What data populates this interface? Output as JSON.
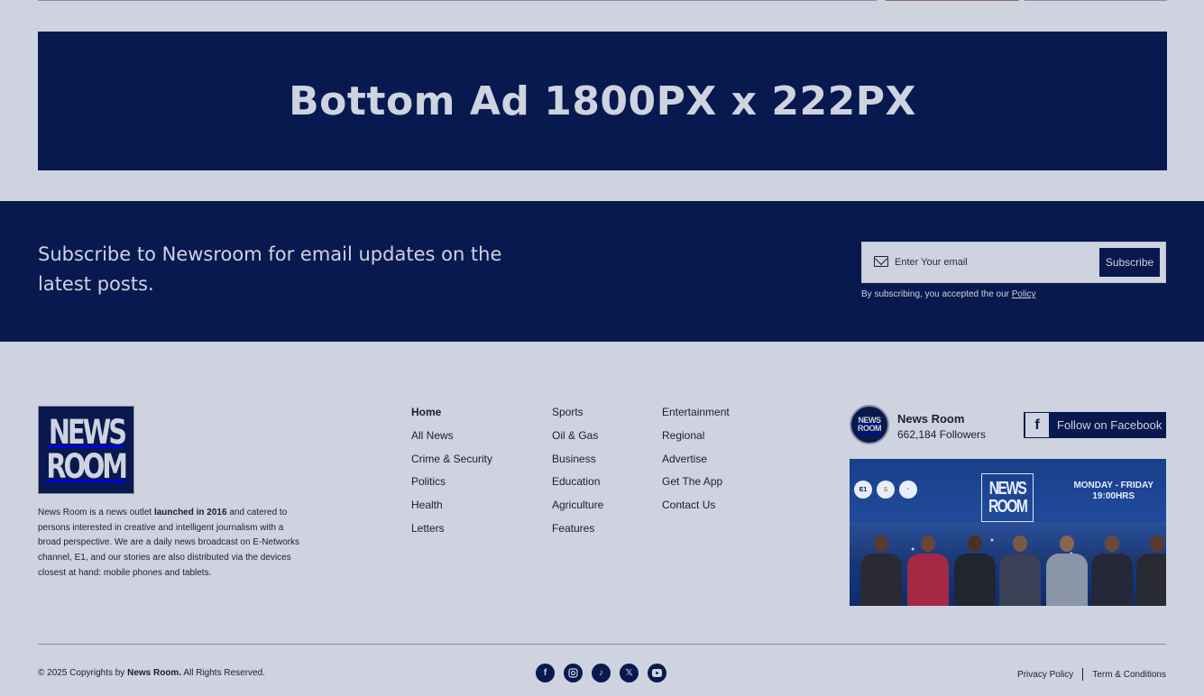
{
  "ad": {
    "text": "Bottom Ad 1800PX x 222PX"
  },
  "subscribe": {
    "headline": "Subscribe to Newsroom for email updates on the latest posts.",
    "placeholder": "Enter Your email",
    "button": "Subscribe",
    "note_prefix": "By subscribing, you accepted the our ",
    "policy_link": "Policy"
  },
  "brand": {
    "logo_line1": "NEWS",
    "logo_line2": "ROOM",
    "about_1": "News Room is a news outlet ",
    "about_bold": "launched in 2016",
    "about_2": " and catered to persons interested in creative and intelligent journalism with a broad perspective. We are a daily news broadcast on E-Networks channel, E1, and our stories are also distributed via the devices closest at hand: mobile phones and tablets."
  },
  "nav": {
    "col1": [
      "Home",
      "All News",
      "Crime & Security",
      "Politics",
      "Health",
      "Letters"
    ],
    "col2": [
      "Sports",
      "Oil & Gas",
      "Business",
      "Education",
      "Agriculture",
      "Features"
    ],
    "col3": [
      "Entertainment",
      "Regional",
      "Advertise",
      "Get The App",
      "Contact Us"
    ]
  },
  "facebook": {
    "page_name": "News Room",
    "followers": "662,184 Followers",
    "follow_label": "Follow on Facebook",
    "icon": "facebook-icon",
    "cover_schedule_1": "MONDAY - FRIDAY",
    "cover_schedule_2": "19:00HRS",
    "cover_logo_1": "NEWS",
    "cover_logo_2": "ROOM"
  },
  "footer": {
    "copyright_prefix": "© 2025 Copyrights by ",
    "copyright_brand": "News Room.",
    "copyright_suffix": " All Rights Reserved.",
    "socials": [
      "facebook-icon",
      "instagram-icon",
      "tiktok-icon",
      "x-icon",
      "youtube-icon"
    ],
    "privacy": "Privacy Policy",
    "terms": "Term & Conditions"
  },
  "colors": {
    "navy": "#081950",
    "background": "#ced3df",
    "text": "#1b1f2e"
  }
}
